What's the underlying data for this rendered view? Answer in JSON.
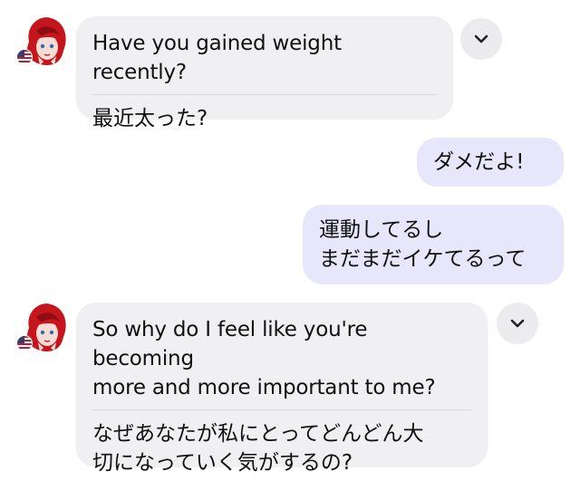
{
  "messages": [
    {
      "id": 1,
      "direction": "incoming",
      "text_en": "Have you gained weight recently?",
      "text_ja": "最近太った?"
    },
    {
      "id": 2,
      "direction": "outgoing",
      "lines": [
        "ダメだよ!"
      ]
    },
    {
      "id": 3,
      "direction": "outgoing",
      "lines": [
        "運動してるし",
        "まだまだイケてるって"
      ]
    },
    {
      "id": 4,
      "direction": "incoming",
      "text_en_lines": [
        "So why do I feel like you're becoming",
        "more and more important to me?"
      ],
      "text_ja_lines": [
        "なぜあなたが私にとってどんどん大",
        "切になっていく気がするの?"
      ]
    }
  ],
  "icons": {
    "expand": "chevron-down-icon",
    "flag": "us-flag-icon",
    "avatar": "avatar-red-hair-girl"
  },
  "colors": {
    "incoming_bubble": "#f0f0f2",
    "outgoing_bubble": "#e8e6fb",
    "divider": "#d9d9dc",
    "chevron_button": "#ececee"
  }
}
